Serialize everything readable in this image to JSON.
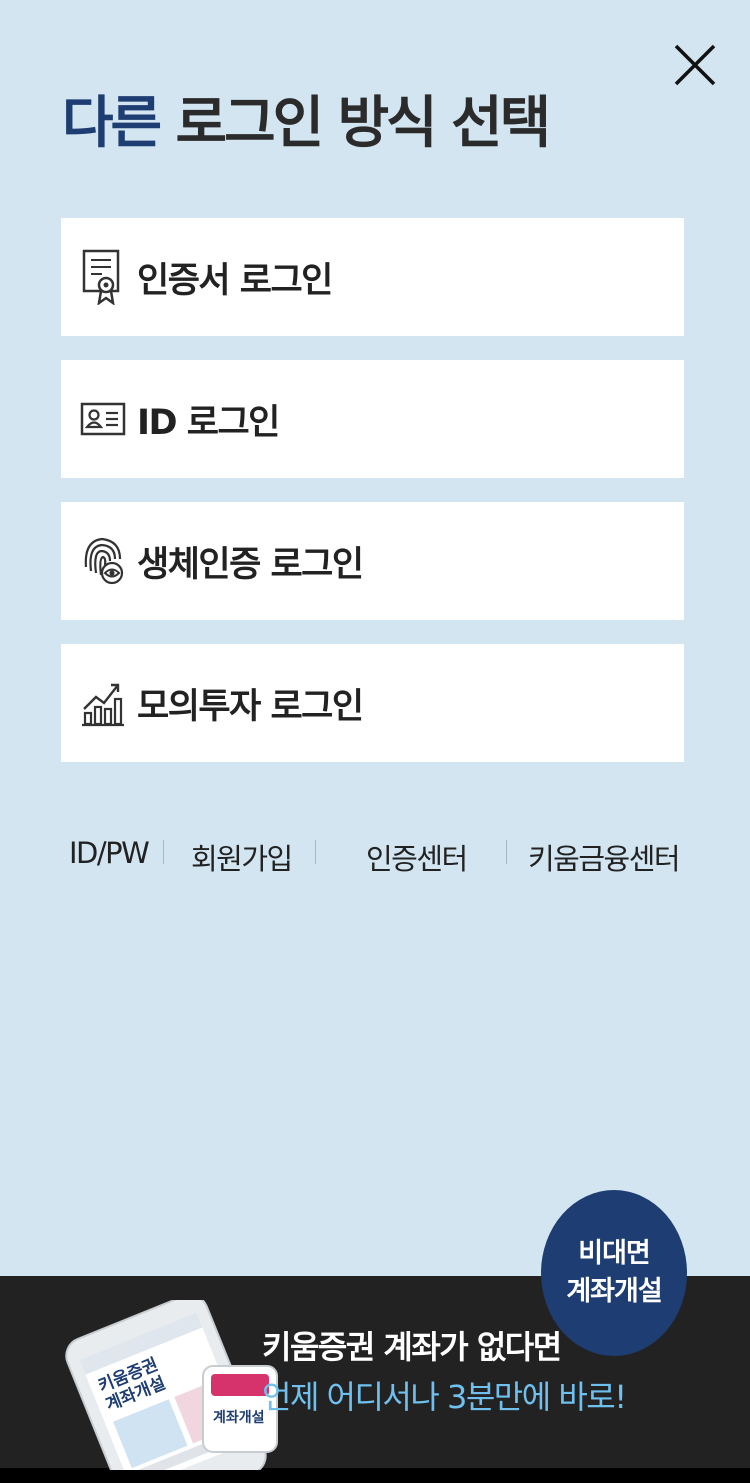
{
  "header": {
    "title_accent": "다른",
    "title_rest": "로그인 방식 선택"
  },
  "login_options": [
    {
      "label": "인증서 로그인",
      "icon": "certificate-icon"
    },
    {
      "label": "ID 로그인",
      "icon": "id-card-icon"
    },
    {
      "label": "생체인증 로그인",
      "icon": "fingerprint-icon"
    },
    {
      "label": "모의투자 로그인",
      "icon": "chart-growth-icon"
    }
  ],
  "links": [
    "ID/PW",
    "회원가입",
    "인증센터",
    "키움금융센터"
  ],
  "banner": {
    "line1": "키움증권 계좌가 없다면",
    "line2": "언제 어디서나 3분만에 바로!",
    "bubble_line1": "비대면",
    "bubble_line2": "계좌개설",
    "phone_text1": "키움증권",
    "phone_text2": "계좌개설"
  },
  "colors": {
    "background": "#d2e5f1",
    "accent": "#1e3d72",
    "banner_bg": "#222222",
    "banner_highlight": "#6fc0ee"
  }
}
